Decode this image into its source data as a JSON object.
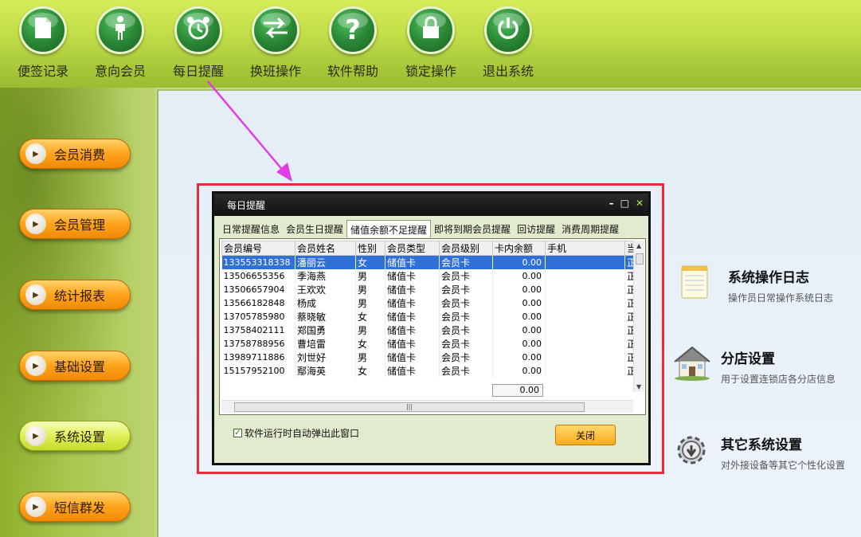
{
  "toolbar": {
    "items": [
      {
        "label": "便签记录",
        "icon": "note-icon"
      },
      {
        "label": "意向会员",
        "icon": "person-icon"
      },
      {
        "label": "每日提醒",
        "icon": "alarm-clock-icon"
      },
      {
        "label": "换班操作",
        "icon": "swap-arrows-icon"
      },
      {
        "label": "软件帮助",
        "icon": "question-icon"
      },
      {
        "label": "锁定操作",
        "icon": "lock-icon"
      },
      {
        "label": "退出系统",
        "icon": "power-icon"
      }
    ]
  },
  "sidebar": {
    "items": [
      {
        "label": "会员消费"
      },
      {
        "label": "会员管理"
      },
      {
        "label": "统计报表"
      },
      {
        "label": "基础设置"
      },
      {
        "label": "系统设置"
      },
      {
        "label": "短信群发"
      }
    ]
  },
  "dialog": {
    "title": "每日提醒",
    "tabs": [
      "日常提醒信息",
      "会员生日提醒",
      "储值余额不足提醒",
      "即将到期会员提醒",
      "回访提醒",
      "消费周期提醒"
    ],
    "columns": [
      "会员编号",
      "会员姓名",
      "性别",
      "会员类型",
      "会员级别",
      "卡内余额",
      "手机",
      "当"
    ],
    "rows": [
      [
        "13355331833​8",
        "潘丽云",
        "女",
        "储值卡",
        "会员卡",
        "0.00",
        "",
        "正"
      ],
      [
        "13506655356",
        "季海燕",
        "男",
        "储值卡",
        "会员卡",
        "0.00",
        "",
        "正"
      ],
      [
        "13506657904",
        "王欢欢",
        "男",
        "储值卡",
        "会员卡",
        "0.00",
        "",
        "正"
      ],
      [
        "13566182848",
        "杨成",
        "男",
        "储值卡",
        "会员卡",
        "0.00",
        "",
        "正"
      ],
      [
        "13705785980",
        "蔡晓敏",
        "女",
        "储值卡",
        "会员卡",
        "0.00",
        "",
        "正"
      ],
      [
        "13758402111",
        "郑国勇",
        "男",
        "储值卡",
        "会员卡",
        "0.00",
        "",
        "正"
      ],
      [
        "13758788956",
        "曹培雷",
        "女",
        "储值卡",
        "会员卡",
        "0.00",
        "",
        "正"
      ],
      [
        "13989711886",
        "刘世好",
        "男",
        "储值卡",
        "会员卡",
        "0.00",
        "",
        "正"
      ],
      [
        "15157952100",
        "鄢海英",
        "女",
        "储值卡",
        "会员卡",
        "0.00",
        "",
        "正"
      ]
    ],
    "total": "0.00",
    "checkbox_label": "软件运行时自动弹出此窗口",
    "close_label": "关闭"
  },
  "right_panel": {
    "items": [
      {
        "title": "系统操作日志",
        "desc": "操作员日常操作系统日志"
      },
      {
        "title": "分店设置",
        "desc": "用于设置连锁店各分店信息"
      },
      {
        "title": "其它系统设置",
        "desc": "对外接设备等其它个性化设置"
      }
    ]
  }
}
